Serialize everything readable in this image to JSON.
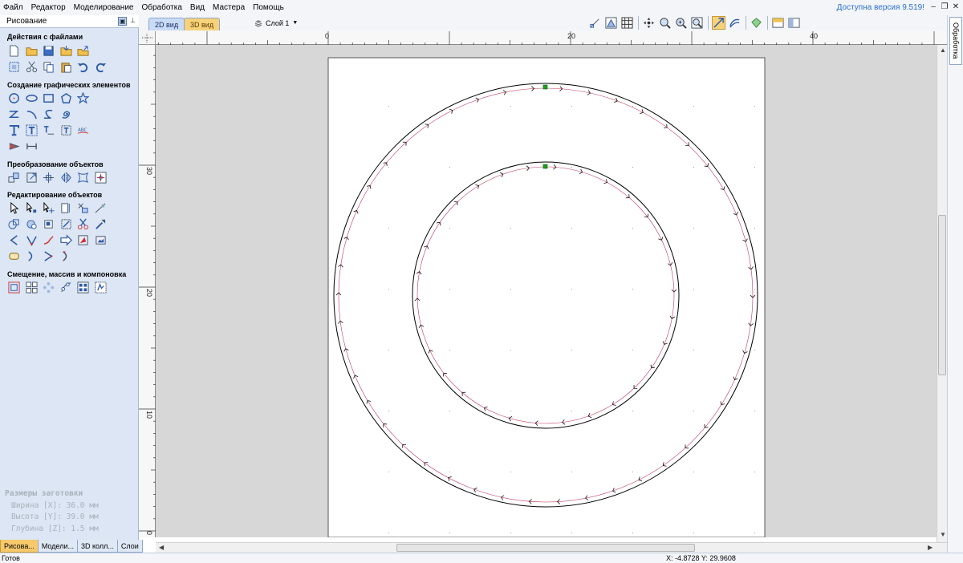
{
  "menu": [
    "Файл",
    "Редактор",
    "Моделирование",
    "Обработка",
    "Вид",
    "Мастера",
    "Помощь"
  ],
  "version_notice": "Доступна версия 9.519!",
  "panel": {
    "title": "Рисование",
    "sections": [
      {
        "title": "Действия с файлами"
      },
      {
        "title": "Создание графических элементов"
      },
      {
        "title": "Преобразование объектов"
      },
      {
        "title": "Редактирование объектов"
      },
      {
        "title": "Смещение, массив и компоновка"
      }
    ],
    "blank": {
      "title": "Размеры заготовки",
      "width": "Ширина  [X]: 36.0 мм",
      "height": "Высота  [Y]: 39.0 мм",
      "depth": "Глубина [Z]: 1.5 мм"
    },
    "bottom_tabs": [
      "Рисова...",
      "Модели...",
      "3D колл...",
      "Слои"
    ]
  },
  "view_tabs": {
    "tab_2d": "2D вид",
    "tab_3d": "3D вид"
  },
  "layer": "Слой 1",
  "right_tab": "Обработка",
  "ruler": {
    "h_labels": [
      "0",
      "20",
      "40"
    ],
    "v_labels": [
      "30",
      "20",
      "10",
      "0"
    ]
  },
  "status": {
    "text": "Готов",
    "coords": "X: -4.8728 Y: 29.9608"
  },
  "colors": {
    "toolpath": "#c0395a",
    "start_marker": "#1aa31a",
    "tool_blue": "#2b58a8"
  }
}
